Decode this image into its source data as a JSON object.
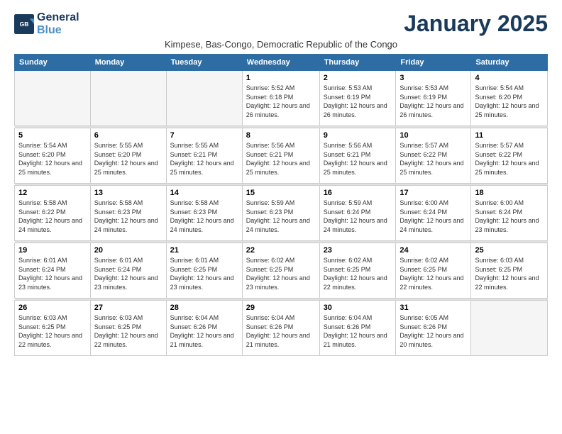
{
  "logo": {
    "line1": "General",
    "line2": "Blue"
  },
  "title": "January 2025",
  "subtitle": "Kimpese, Bas-Congo, Democratic Republic of the Congo",
  "days_of_week": [
    "Sunday",
    "Monday",
    "Tuesday",
    "Wednesday",
    "Thursday",
    "Friday",
    "Saturday"
  ],
  "weeks": [
    [
      {
        "day": "",
        "info": ""
      },
      {
        "day": "",
        "info": ""
      },
      {
        "day": "",
        "info": ""
      },
      {
        "day": "1",
        "info": "Sunrise: 5:52 AM\nSunset: 6:18 PM\nDaylight: 12 hours and 26 minutes."
      },
      {
        "day": "2",
        "info": "Sunrise: 5:53 AM\nSunset: 6:19 PM\nDaylight: 12 hours and 26 minutes."
      },
      {
        "day": "3",
        "info": "Sunrise: 5:53 AM\nSunset: 6:19 PM\nDaylight: 12 hours and 26 minutes."
      },
      {
        "day": "4",
        "info": "Sunrise: 5:54 AM\nSunset: 6:20 PM\nDaylight: 12 hours and 25 minutes."
      }
    ],
    [
      {
        "day": "5",
        "info": "Sunrise: 5:54 AM\nSunset: 6:20 PM\nDaylight: 12 hours and 25 minutes."
      },
      {
        "day": "6",
        "info": "Sunrise: 5:55 AM\nSunset: 6:20 PM\nDaylight: 12 hours and 25 minutes."
      },
      {
        "day": "7",
        "info": "Sunrise: 5:55 AM\nSunset: 6:21 PM\nDaylight: 12 hours and 25 minutes."
      },
      {
        "day": "8",
        "info": "Sunrise: 5:56 AM\nSunset: 6:21 PM\nDaylight: 12 hours and 25 minutes."
      },
      {
        "day": "9",
        "info": "Sunrise: 5:56 AM\nSunset: 6:21 PM\nDaylight: 12 hours and 25 minutes."
      },
      {
        "day": "10",
        "info": "Sunrise: 5:57 AM\nSunset: 6:22 PM\nDaylight: 12 hours and 25 minutes."
      },
      {
        "day": "11",
        "info": "Sunrise: 5:57 AM\nSunset: 6:22 PM\nDaylight: 12 hours and 25 minutes."
      }
    ],
    [
      {
        "day": "12",
        "info": "Sunrise: 5:58 AM\nSunset: 6:22 PM\nDaylight: 12 hours and 24 minutes."
      },
      {
        "day": "13",
        "info": "Sunrise: 5:58 AM\nSunset: 6:23 PM\nDaylight: 12 hours and 24 minutes."
      },
      {
        "day": "14",
        "info": "Sunrise: 5:58 AM\nSunset: 6:23 PM\nDaylight: 12 hours and 24 minutes."
      },
      {
        "day": "15",
        "info": "Sunrise: 5:59 AM\nSunset: 6:23 PM\nDaylight: 12 hours and 24 minutes."
      },
      {
        "day": "16",
        "info": "Sunrise: 5:59 AM\nSunset: 6:24 PM\nDaylight: 12 hours and 24 minutes."
      },
      {
        "day": "17",
        "info": "Sunrise: 6:00 AM\nSunset: 6:24 PM\nDaylight: 12 hours and 24 minutes."
      },
      {
        "day": "18",
        "info": "Sunrise: 6:00 AM\nSunset: 6:24 PM\nDaylight: 12 hours and 23 minutes."
      }
    ],
    [
      {
        "day": "19",
        "info": "Sunrise: 6:01 AM\nSunset: 6:24 PM\nDaylight: 12 hours and 23 minutes."
      },
      {
        "day": "20",
        "info": "Sunrise: 6:01 AM\nSunset: 6:24 PM\nDaylight: 12 hours and 23 minutes."
      },
      {
        "day": "21",
        "info": "Sunrise: 6:01 AM\nSunset: 6:25 PM\nDaylight: 12 hours and 23 minutes."
      },
      {
        "day": "22",
        "info": "Sunrise: 6:02 AM\nSunset: 6:25 PM\nDaylight: 12 hours and 23 minutes."
      },
      {
        "day": "23",
        "info": "Sunrise: 6:02 AM\nSunset: 6:25 PM\nDaylight: 12 hours and 22 minutes."
      },
      {
        "day": "24",
        "info": "Sunrise: 6:02 AM\nSunset: 6:25 PM\nDaylight: 12 hours and 22 minutes."
      },
      {
        "day": "25",
        "info": "Sunrise: 6:03 AM\nSunset: 6:25 PM\nDaylight: 12 hours and 22 minutes."
      }
    ],
    [
      {
        "day": "26",
        "info": "Sunrise: 6:03 AM\nSunset: 6:25 PM\nDaylight: 12 hours and 22 minutes."
      },
      {
        "day": "27",
        "info": "Sunrise: 6:03 AM\nSunset: 6:25 PM\nDaylight: 12 hours and 22 minutes."
      },
      {
        "day": "28",
        "info": "Sunrise: 6:04 AM\nSunset: 6:26 PM\nDaylight: 12 hours and 21 minutes."
      },
      {
        "day": "29",
        "info": "Sunrise: 6:04 AM\nSunset: 6:26 PM\nDaylight: 12 hours and 21 minutes."
      },
      {
        "day": "30",
        "info": "Sunrise: 6:04 AM\nSunset: 6:26 PM\nDaylight: 12 hours and 21 minutes."
      },
      {
        "day": "31",
        "info": "Sunrise: 6:05 AM\nSunset: 6:26 PM\nDaylight: 12 hours and 20 minutes."
      },
      {
        "day": "",
        "info": ""
      }
    ]
  ]
}
